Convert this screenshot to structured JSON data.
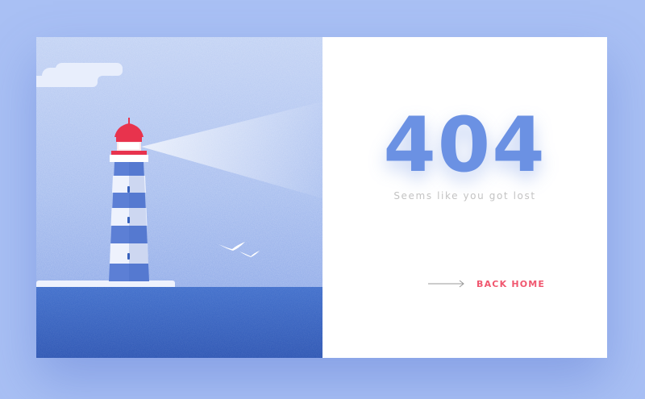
{
  "error": {
    "code": "404",
    "message": "Seems like you got lost"
  },
  "navigation": {
    "back_label": "BACK HOME",
    "arrow_icon": "arrow-right-icon"
  },
  "colors": {
    "background": "#a9c0f4",
    "accent_blue": "#6b91e3",
    "link_red": "#f0576f",
    "subtitle_gray": "#c3c3c3",
    "sky": "#b6c9f1",
    "sea": "#3862bd",
    "lighthouse_roof": "#e8334d"
  }
}
